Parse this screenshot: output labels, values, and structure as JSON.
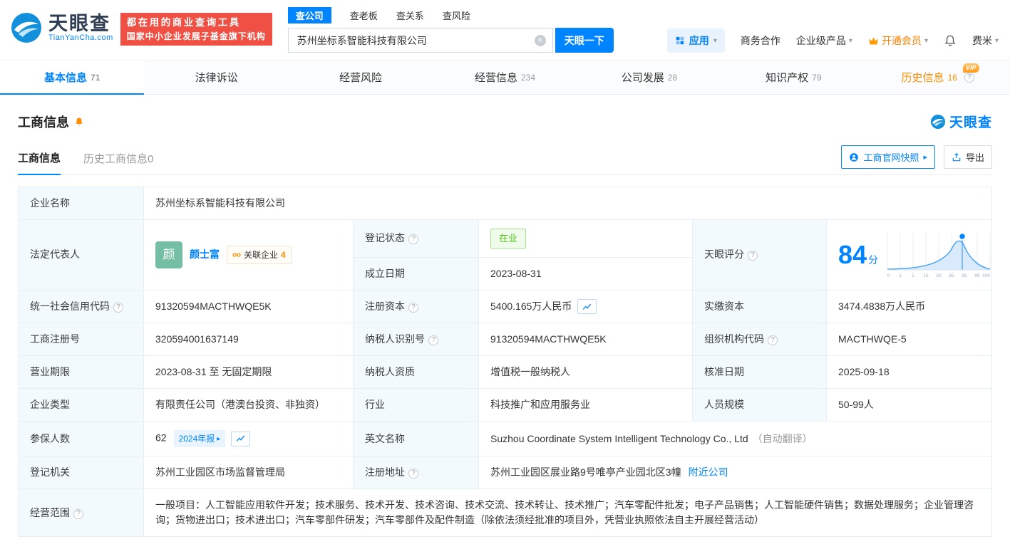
{
  "vip_label": "VIP",
  "header": {
    "logo": {
      "brand": "天眼查",
      "domain": "TianYanCha.com"
    },
    "banner": {
      "line1": "都在用的商业查询工具",
      "line2": "国家中小企业发展子基金旗下机构"
    },
    "search": {
      "tabs": [
        {
          "label": "查公司"
        },
        {
          "label": "查老板"
        },
        {
          "label": "查关系"
        },
        {
          "label": "查风险"
        }
      ],
      "value": "苏州坐标系智能科技有限公司",
      "button": "天眼一下"
    },
    "nav": {
      "apps": "应用",
      "cooperation": "商务合作",
      "products": "企业级产品",
      "vip": "开通会员",
      "user": "费米"
    }
  },
  "tabs": [
    {
      "label": "基本信息",
      "count": "71"
    },
    {
      "label": "法律诉讼",
      "count": ""
    },
    {
      "label": "经营风险",
      "count": ""
    },
    {
      "label": "经营信息",
      "count": "234"
    },
    {
      "label": "公司发展",
      "count": "28"
    },
    {
      "label": "知识产权",
      "count": "79"
    },
    {
      "label": "历史信息",
      "count": "16"
    }
  ],
  "section": {
    "title": "工商信息",
    "brand": "天眼查",
    "subtabs": [
      {
        "label": "工商信息"
      },
      {
        "label": "历史工商信息0"
      }
    ],
    "snapshot_button": "工商官网快照",
    "export_button": "导出"
  },
  "fields": {
    "company_name": {
      "label": "企业名称",
      "value": "苏州坐标系智能科技有限公司"
    },
    "legal_rep": {
      "label": "法定代表人",
      "avatar": "颜",
      "name": "颜士富",
      "related_label": "关联企业",
      "related_count": "4"
    },
    "reg_status": {
      "label": "登记状态",
      "value": "在业"
    },
    "establish_date": {
      "label": "成立日期",
      "value": "2023-08-31"
    },
    "score": {
      "label": "天眼评分",
      "value": "84",
      "unit": "分"
    },
    "credit_code": {
      "label": "统一社会信用代码",
      "value": "91320594MACTHWQE5K"
    },
    "reg_capital": {
      "label": "注册资本",
      "value": "5400.165万人民币"
    },
    "paid_capital": {
      "label": "实缴资本",
      "value": "3474.4838万人民币"
    },
    "reg_number": {
      "label": "工商注册号",
      "value": "320594001637149"
    },
    "taxpayer_id": {
      "label": "纳税人识别号",
      "value": "91320594MACTHWQE5K"
    },
    "org_code": {
      "label": "组织机构代码",
      "value": "MACTHWQE-5"
    },
    "business_term": {
      "label": "营业期限",
      "value": "2023-08-31 至 无固定期限"
    },
    "taxpayer_quality": {
      "label": "纳税人资质",
      "value": "增值税一般纳税人"
    },
    "approval_date": {
      "label": "核准日期",
      "value": "2025-09-18"
    },
    "company_type": {
      "label": "企业类型",
      "value": "有限责任公司（港澳台投资、非独资）"
    },
    "industry": {
      "label": "行业",
      "value": "科技推广和应用服务业"
    },
    "staff_size": {
      "label": "人员规模",
      "value": "50-99人"
    },
    "insured": {
      "label": "参保人数",
      "value": "62",
      "badge": "2024年报"
    },
    "english_name": {
      "label": "英文名称",
      "value": "Suzhou Coordinate System Intelligent Technology Co., Ltd",
      "note": "（自动翻译）"
    },
    "reg_authority": {
      "label": "登记机关",
      "value": "苏州工业园区市场监督管理局"
    },
    "reg_address": {
      "label": "注册地址",
      "value": "苏州工业园区展业路9号唯亭产业园北区3幢",
      "link": "附近公司"
    },
    "business_scope": {
      "label": "经营范围",
      "value": "一般项目：人工智能应用软件开发；技术服务、技术开发、技术咨询、技术交流、技术转让、技术推广；汽车零配件批发；电子产品销售；人工智能硬件销售；数据处理服务；企业管理咨询；货物进出口；技术进出口；汽车零部件研发；汽车零部件及配件制造（除依法须经批准的项目外，凭营业执照依法自主开展经营活动）"
    }
  },
  "score_chart": {
    "ticks": [
      "0",
      "1",
      "5",
      "15",
      "50",
      "85",
      "95",
      "99",
      "100"
    ]
  }
}
